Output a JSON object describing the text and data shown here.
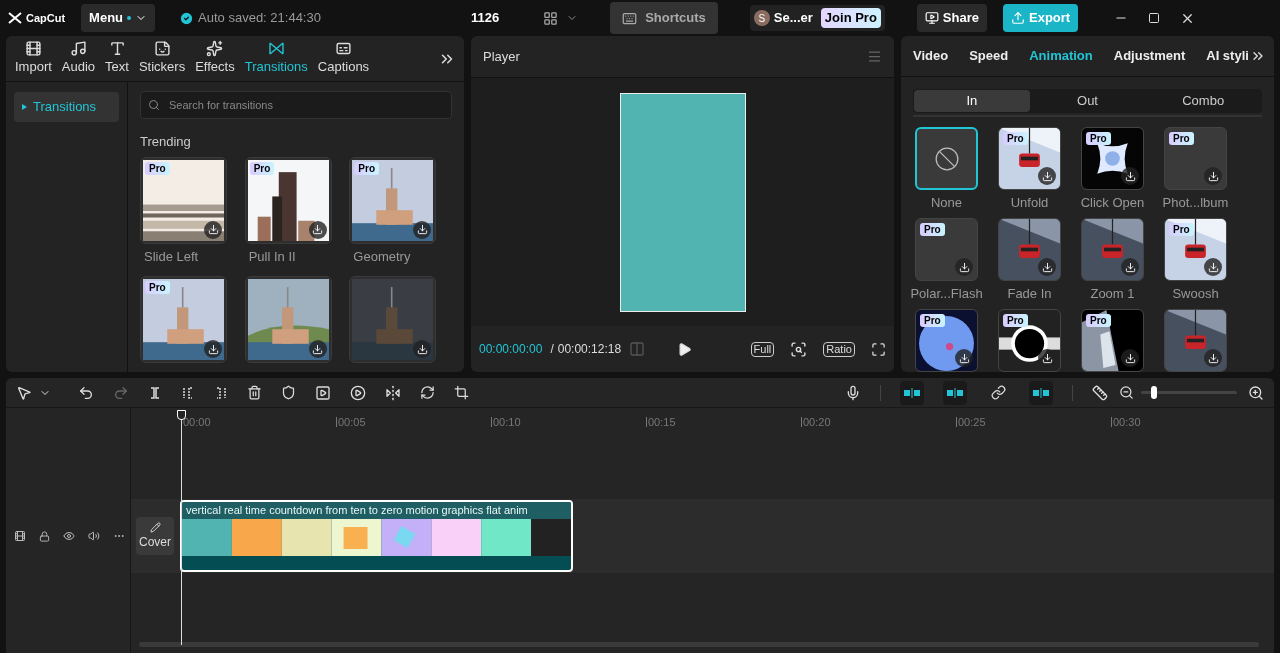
{
  "app": {
    "name": "CapCut",
    "menu": "Menu",
    "autosave": "Auto saved: 21:44:30",
    "project": "1126",
    "shortcuts": "Shortcuts",
    "user_initial": "S",
    "user_name": "Se...er",
    "join_pro": "Join Pro",
    "share": "Share",
    "export": "Export"
  },
  "media_tabs": [
    {
      "label": "Import",
      "selected": false
    },
    {
      "label": "Audio",
      "selected": false
    },
    {
      "label": "Text",
      "selected": false
    },
    {
      "label": "Stickers",
      "selected": false
    },
    {
      "label": "Effects",
      "selected": false
    },
    {
      "label": "Transitions",
      "selected": true
    },
    {
      "label": "Captions",
      "selected": false
    }
  ],
  "sidebar": {
    "items": [
      {
        "label": "Transitions",
        "selected": true
      }
    ]
  },
  "search": {
    "placeholder": "Search for transitions"
  },
  "section_title": "Trending",
  "transitions": [
    {
      "label": "Slide Left",
      "badge": "Pro",
      "selected": false
    },
    {
      "label": "Pull In II",
      "badge": "Pro",
      "selected": false
    },
    {
      "label": "Geometry",
      "badge": "Pro",
      "selected": false
    },
    {
      "badge": "Pro",
      "selected": false
    },
    {
      "selected": false
    },
    {
      "selected": false
    }
  ],
  "player": {
    "title": "Player",
    "current": "00:00:00:00",
    "separator": "/",
    "total": "00:00:12:18",
    "buttons": [
      "Full",
      "Ratio"
    ]
  },
  "inspector_tabs": [
    {
      "label": "Video",
      "selected": false
    },
    {
      "label": "Speed",
      "selected": false
    },
    {
      "label": "Animation",
      "selected": true
    },
    {
      "label": "Adjustment",
      "selected": false
    },
    {
      "label": "AI styli",
      "selected": false
    }
  ],
  "segments": [
    {
      "label": "In",
      "selected": true
    },
    {
      "label": "Out",
      "selected": false
    },
    {
      "label": "Combo",
      "selected": false
    }
  ],
  "animations": [
    {
      "label": "None",
      "kind": "none",
      "selected": true
    },
    {
      "label": "Unfold",
      "kind": "picture",
      "badge": "Pro",
      "selected": false
    },
    {
      "label": "Click Open",
      "kind": "picture",
      "badge": "Pro",
      "selected": false
    },
    {
      "label": "Phot...lbum",
      "kind": "blank",
      "badge": "Pro",
      "selected": false
    },
    {
      "label": "Polar...Flash",
      "kind": "blank",
      "badge": "Pro",
      "selected": false
    },
    {
      "label": "Fade In",
      "kind": "picture",
      "selected": false
    },
    {
      "label": "Zoom 1",
      "kind": "picture",
      "selected": false
    },
    {
      "label": "Swoosh",
      "kind": "picture",
      "badge": "Pro",
      "selected": false
    },
    {
      "kind": "picture",
      "badge": "Pro",
      "selected": false
    },
    {
      "kind": "picture",
      "badge": "Pro",
      "selected": false
    },
    {
      "kind": "picture",
      "badge": "Pro",
      "selected": false
    },
    {
      "kind": "picture",
      "selected": false
    }
  ],
  "timeline": {
    "toggles": [
      {
        "on": true
      },
      {
        "on": true
      },
      {
        "on": false
      },
      {
        "on": true
      }
    ],
    "zoom": {
      "level": 0.12
    },
    "ruler": [
      "00:00",
      "00:05",
      "00:10",
      "00:15",
      "00:20",
      "00:25",
      "00:30"
    ],
    "cover": "Cover",
    "clip": {
      "caption": "vertical real time countdown from ten to zero motion graphics flat anim"
    }
  }
}
